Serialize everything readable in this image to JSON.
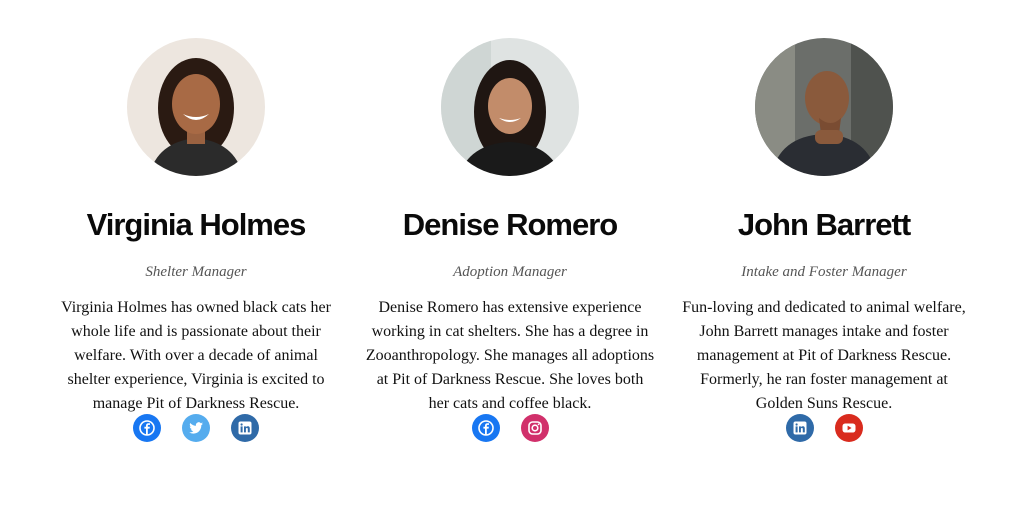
{
  "colors": {
    "facebook": "#1877f2",
    "twitter": "#55acee",
    "linkedin": "#2f6aa8",
    "instagram": "#d1306b",
    "youtube": "#d92b1e"
  },
  "members": [
    {
      "name": "Virginia Holmes",
      "role": "Shelter Manager",
      "bio": "Virginia Holmes has owned black cats her whole life and is passionate about their welfare. With over a decade of animal shelter experience, Virginia is excited to manage Pit of Darkness Rescue.",
      "socials": [
        "facebook-icon",
        "twitter-icon",
        "linkedin-icon"
      ]
    },
    {
      "name": "Denise Romero",
      "role": "Adoption Manager",
      "bio": "Denise Romero has extensive experience working in cat shelters. She has a degree in Zooanthropology. She manages all adoptions at Pit of Darkness Rescue. She loves both her cats and coffee black.",
      "socials": [
        "facebook-icon",
        "instagram-icon"
      ]
    },
    {
      "name": "John Barrett",
      "role": "Intake and Foster Manager",
      "bio": "Fun-loving and dedicated to animal welfare, John Barrett manages intake and foster management at Pit of Darkness Rescue. Formerly, he ran foster management at Golden Suns Rescue.",
      "socials": [
        "linkedin-icon",
        "youtube-icon"
      ]
    }
  ]
}
